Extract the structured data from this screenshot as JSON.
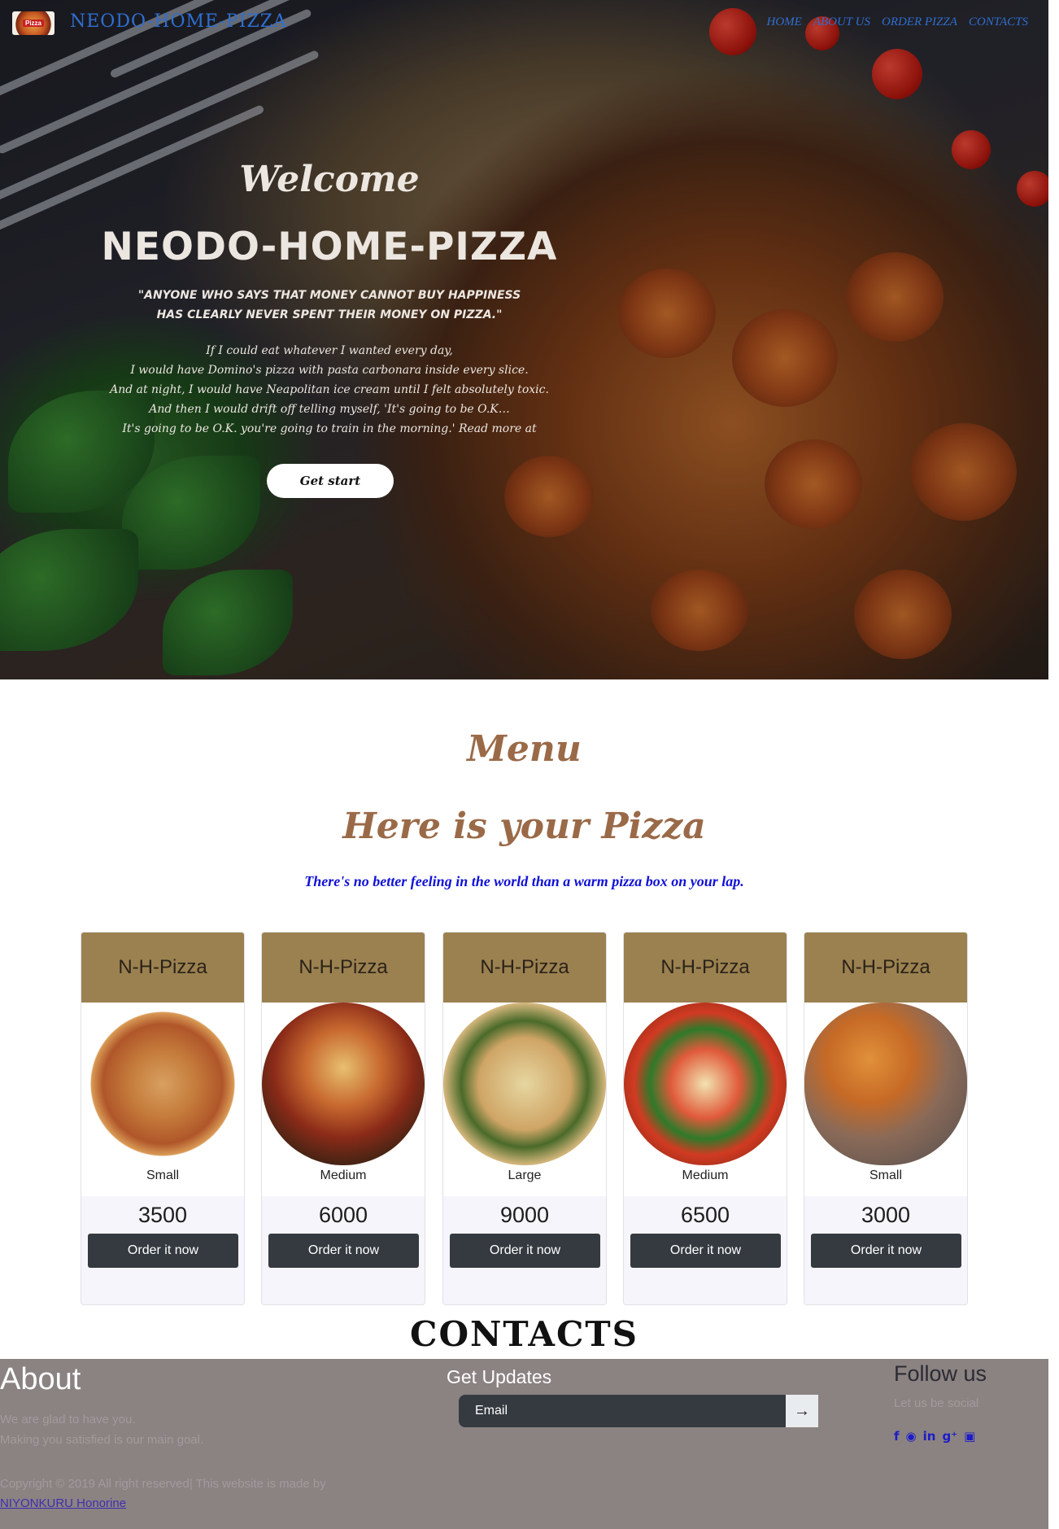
{
  "navbar": {
    "logo_text": "Pizza",
    "brand": "NEODO-HOME-PIZZA",
    "links": [
      "HOME",
      "ABOUT US",
      "ORDER PIZZA",
      "CONTACTS"
    ]
  },
  "hero": {
    "welcome": "Welcome",
    "title": "NEODO-HOME-PIZZA",
    "quote_lines": [
      "\"ANYONE WHO SAYS THAT MONEY CANNOT BUY HAPPINESS",
      "HAS CLEARLY NEVER SPENT THEIR MONEY ON PIZZA.\""
    ],
    "poem_lines": [
      "If I could eat whatever I wanted every day,",
      "I would have Domino's pizza with pasta carbonara inside every slice.",
      "And at night, I would have Neapolitan ice cream until I felt absolutely toxic.",
      "And then I would drift off telling myself, 'It's going to be O.K…",
      "It's going to be O.K. you're going to train in the morning.' Read more at"
    ],
    "button": "Get start"
  },
  "menu": {
    "heading": "Menu",
    "subheading": "Here is your Pizza",
    "tagline": "There's no better feeling in the world than a warm pizza box on your lap.",
    "cards": [
      {
        "name": "N-H-Pizza",
        "size": "Small",
        "price": "3500",
        "button": "Order it now"
      },
      {
        "name": "N-H-Pizza",
        "size": "Medium",
        "price": "6000",
        "button": "Order it now"
      },
      {
        "name": "N-H-Pizza",
        "size": "Large",
        "price": "9000",
        "button": "Order it now"
      },
      {
        "name": "N-H-Pizza",
        "size": "Medium",
        "price": "6500",
        "button": "Order it now"
      },
      {
        "name": "N-H-Pizza",
        "size": "Small",
        "price": "3000",
        "button": "Order it now"
      }
    ]
  },
  "contacts": {
    "title": "CONTACTS",
    "about_title": "About",
    "about_lines": [
      "We are glad to have you.",
      "Making you satisfied is our main goal."
    ],
    "updates_title": "Get Updates",
    "email_placeholder": "Email",
    "email_submit_icon": "→",
    "follow_title": "Follow us",
    "follow_sub": "Let us be social",
    "socials": [
      {
        "icon": "facebook-icon",
        "glyph": "f"
      },
      {
        "icon": "github-icon",
        "glyph": "◉"
      },
      {
        "icon": "linkedin-icon",
        "glyph": "in"
      },
      {
        "icon": "google-plus-icon",
        "glyph": "g⁺"
      },
      {
        "icon": "instagram-icon",
        "glyph": "▣"
      }
    ],
    "copyright": "Copyright © 2019 All right reserved| This website is made by",
    "author": "NIYONKURU Honorine"
  },
  "colors": {
    "brand_blue": "#2f6fd0",
    "menu_brown": "#9a6a48",
    "card_header": "#9b8150",
    "button_dark": "#343a40",
    "footer_bg": "#8b8282",
    "tagline_blue": "#1010d8"
  }
}
